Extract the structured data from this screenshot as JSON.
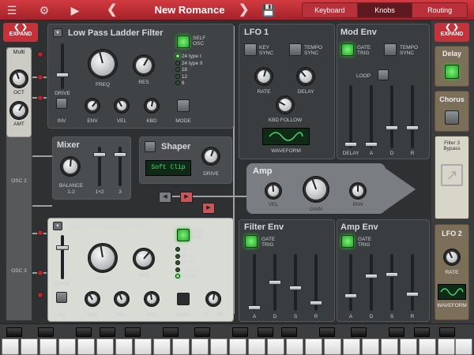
{
  "top_bar": {
    "preset_name": "New Romance",
    "tabs": [
      "Keyboard",
      "Knobs",
      "Routing"
    ],
    "active_tab": "Knobs",
    "icons": [
      "logo-icon",
      "gear-icon",
      "video-icon",
      "prev-arrow-icon",
      "next-arrow-icon",
      "save-icon"
    ]
  },
  "left_expand": "EXPAND",
  "right_expand": "EXPAND",
  "left_sections": {
    "multi": "Multi",
    "oct": "OCT",
    "amt": "AMT",
    "osc2": "OSC 2",
    "osc3": "OSC 3"
  },
  "lp_filter": {
    "title": "Low Pass Ladder Filter",
    "self_osc": "SELF OSC",
    "labels": {
      "drive": "DRIVE",
      "freq": "FREQ",
      "res": "RES",
      "inv": "INV",
      "env": "ENV",
      "vel": "VEL",
      "kbd": "KBD",
      "mode": "MODE"
    },
    "modes": [
      "24 type I",
      "24 type II",
      "18",
      "12",
      "6"
    ],
    "active_mode_index": 0
  },
  "mixer": {
    "title": "Mixer",
    "balance": "BALANCE",
    "balance_sub": "1-2",
    "ch12": "1+2",
    "ch3": "3"
  },
  "shaper": {
    "title": "Shaper",
    "display": "Soft Clip",
    "drive": "DRIVE"
  },
  "sv_filter": {
    "title": "State Variable Filter",
    "self_osc": "SELF OSC",
    "labels": {
      "drive": "DRIVE",
      "freq": "FREQ",
      "res": "RES",
      "inv": "INV",
      "env": "ENV",
      "vel": "VEL",
      "kbd": "KBD",
      "mode": "MODE",
      "lp": "LP",
      "hp": "HP"
    },
    "modes": [
      "LP 12",
      "BP 12",
      "HP 12",
      "NOTCH",
      "PEAK"
    ],
    "active_mode_index": 4
  },
  "lfo1": {
    "title": "LFO 1",
    "key_sync": "KEY SYNC",
    "tempo_sync": "TEMPO SYNC",
    "rate": "RATE",
    "delay": "DELAY",
    "kbd_follow": "KBD FOLLOW",
    "waveform": "WAVEFORM"
  },
  "mod_env": {
    "title": "Mod Env",
    "gate_trig": "GATE TRIG",
    "tempo_sync": "TEMPO SYNC",
    "loop": "LOOP",
    "sliders": [
      "DELAY",
      "A",
      "D",
      "R"
    ]
  },
  "amp": {
    "title": "Amp",
    "vel": "VEL",
    "gain": "GAIN",
    "pan": "PAN"
  },
  "filter_env": {
    "title": "Filter Env",
    "gate_trig": "GATE TRIG",
    "sliders": [
      "A",
      "D",
      "S",
      "R"
    ]
  },
  "amp_env": {
    "title": "Amp Env",
    "gate_trig": "GATE TRIG",
    "sliders": [
      "A",
      "D",
      "S",
      "R"
    ]
  },
  "sidebar": {
    "delay": "Delay",
    "chorus": "Chorus",
    "filter3": "Filter 3 Bypass",
    "lfo2": "LFO 2",
    "rate": "RATE",
    "waveform": "WAVEFORM"
  },
  "colors": {
    "accent": "#c4323a",
    "led_green": "#33cc33",
    "lcd_text": "#52d77a"
  }
}
